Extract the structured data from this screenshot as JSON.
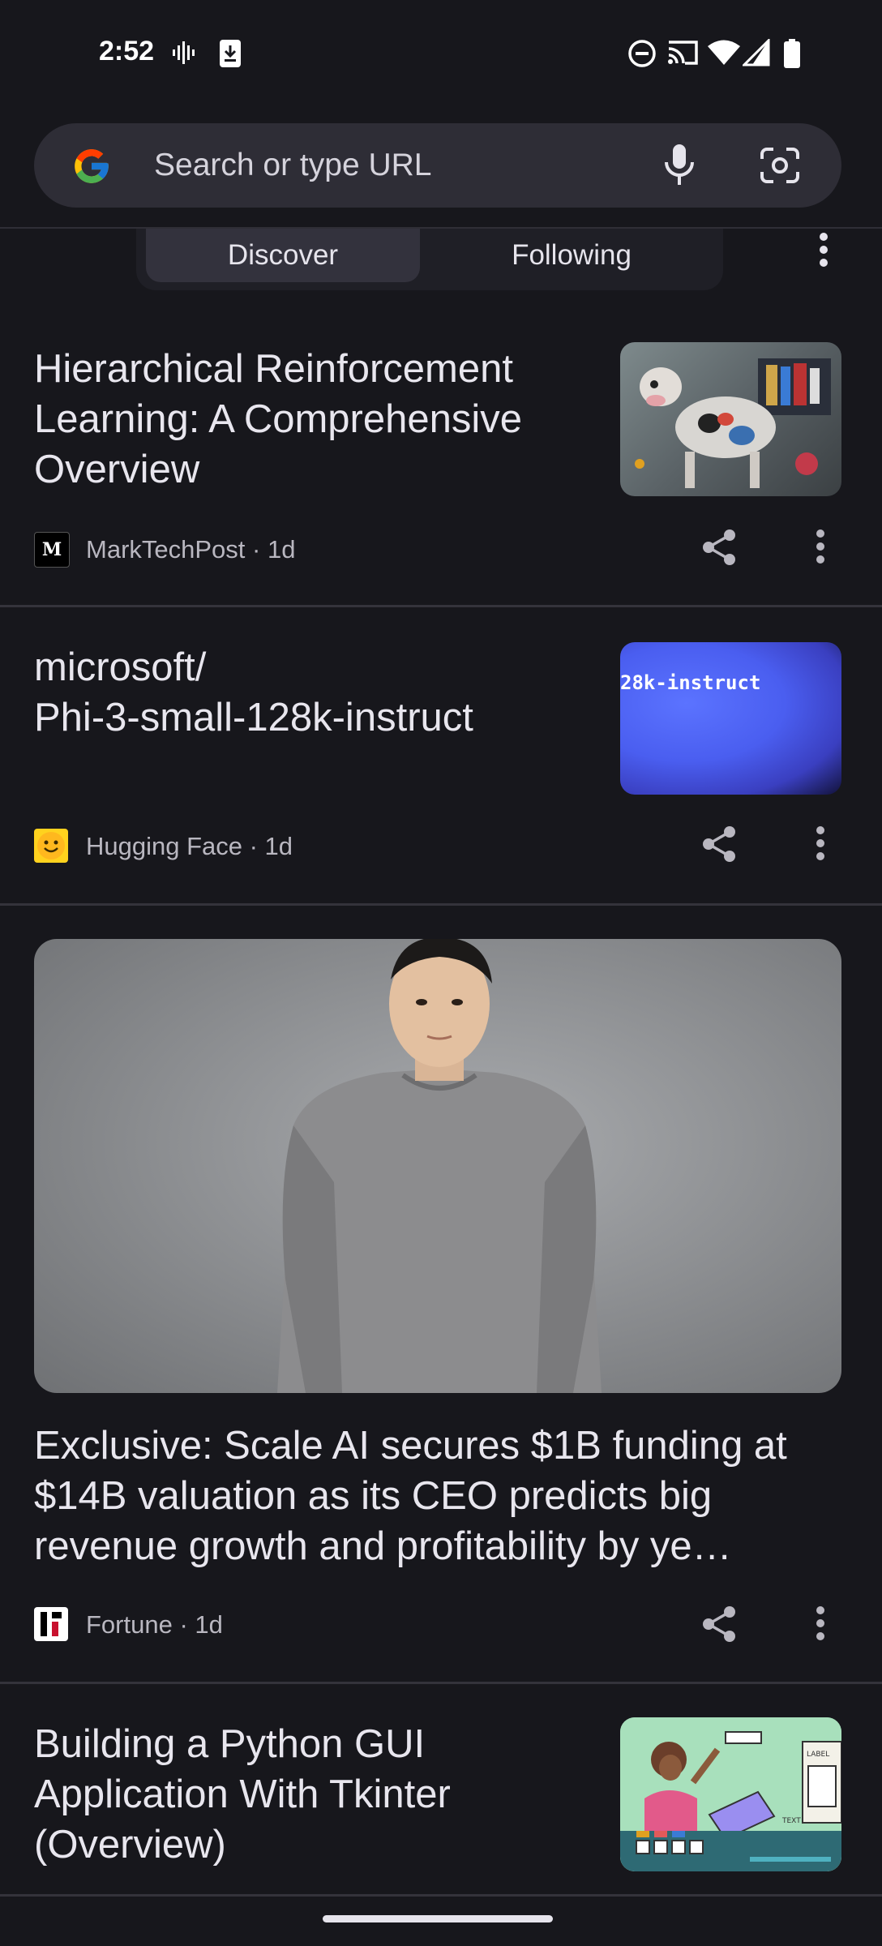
{
  "status_bar": {
    "time": "2:52",
    "icons": [
      "voicemail-wave-icon",
      "download-icon",
      "do-not-disturb-icon",
      "cast-icon",
      "wifi-icon",
      "signal-icon",
      "battery-icon"
    ]
  },
  "search": {
    "placeholder": "Search or type URL",
    "icons": [
      "google-logo",
      "microphone-icon",
      "lens-icon"
    ]
  },
  "tabs": [
    {
      "label": "Discover",
      "active": true
    },
    {
      "label": "Following",
      "active": false
    }
  ],
  "cards": [
    {
      "title": "Hierarchical Reinforcement Learning: A Comprehensive Overview",
      "source": "MarkTechPost",
      "age": "1d",
      "meta": "MarkTechPost · 1d"
    },
    {
      "title": "microsoft/ Phi-3-small-128k-instruct",
      "title_line1": "microsoft/",
      "title_line2": "Phi-3-small-128k-instruct",
      "thumb_text": "28k-instruct",
      "source": "Hugging Face",
      "age": "1d",
      "meta": "Hugging Face · 1d"
    },
    {
      "title": "Exclusive: Scale AI secures $1B funding at $14B valuation as its CEO predicts big revenue growth and profitability by ye…",
      "source": "Fortune",
      "age": "1d",
      "meta": "Fortune · 1d"
    },
    {
      "title": "Building a Python GUI Application With Tkinter (Overview)",
      "thumb_text": "LABEL",
      "thumb_text2": "TEXT"
    }
  ],
  "colors": {
    "background": "#17171c",
    "search_bg": "#2e2d36",
    "tab_active": "#33323d",
    "text_primary": "#e8e6ee",
    "text_secondary": "#b9b7c0"
  }
}
